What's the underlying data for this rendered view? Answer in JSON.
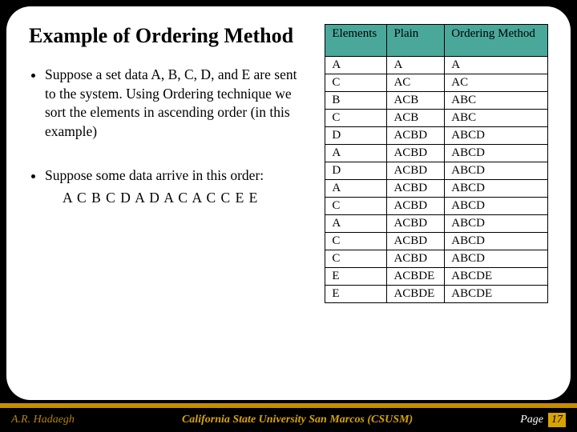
{
  "title": "Example of Ordering  Method",
  "bullets": [
    "Suppose a set data A, B, C, D, and E are sent to the system. Using Ordering technique we sort the elements in ascending order (in this example)"
  ],
  "bullet2_intro": "Suppose some data arrive in this order:",
  "bullet2_sequence": "A C B C D A D A C A C C E E",
  "table": {
    "headers": [
      "Elements",
      "Plain",
      "Ordering Method"
    ],
    "rows": [
      [
        "A",
        "A",
        "A"
      ],
      [
        "C",
        "AC",
        "AC"
      ],
      [
        "B",
        "ACB",
        "ABC"
      ],
      [
        "C",
        "ACB",
        "ABC"
      ],
      [
        "D",
        "ACBD",
        "ABCD"
      ],
      [
        "A",
        "ACBD",
        "ABCD"
      ],
      [
        "D",
        "ACBD",
        "ABCD"
      ],
      [
        "A",
        "ACBD",
        "ABCD"
      ],
      [
        "C",
        "ACBD",
        "ABCD"
      ],
      [
        "A",
        "ACBD",
        "ABCD"
      ],
      [
        "C",
        "ACBD",
        "ABCD"
      ],
      [
        "C",
        "ACBD",
        "ABCD"
      ],
      [
        "E",
        "ACBDE",
        "ABCDE"
      ],
      [
        "E",
        "ACBDE",
        "ABCDE"
      ]
    ]
  },
  "footer": {
    "author": "A.R. Hadaegh",
    "center": "California State University San Marcos (CSUSM)",
    "page_label": "Page",
    "page_num": "17"
  }
}
